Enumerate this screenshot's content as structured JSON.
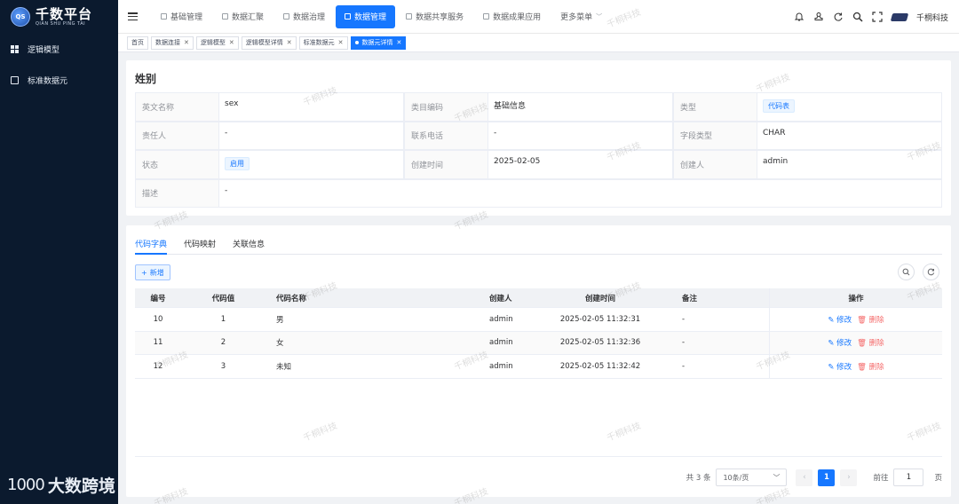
{
  "sidebar": {
    "logo_badge": "QS",
    "logo_title": "千数平台",
    "logo_subtitle": "QIAN SHU PING TAI",
    "items": [
      {
        "label": "逻辑模型",
        "icon": "grid-icon"
      },
      {
        "label": "标准数据元",
        "icon": "document-icon"
      }
    ],
    "brand_mark": "1000",
    "brand_text": "大数跨境"
  },
  "topnav": {
    "items": [
      {
        "label": "基础管理"
      },
      {
        "label": "数据汇聚"
      },
      {
        "label": "数据治理"
      },
      {
        "label": "数据管理",
        "active": true
      },
      {
        "label": "数据共享服务"
      },
      {
        "label": "数据成果应用"
      },
      {
        "label": "更多菜单"
      }
    ],
    "company": "千桐科技"
  },
  "tabs": [
    {
      "label": "首页",
      "closable": false
    },
    {
      "label": "数据连接",
      "closable": true
    },
    {
      "label": "逻辑模型",
      "closable": true
    },
    {
      "label": "逻辑模型详情",
      "closable": true
    },
    {
      "label": "标准数据元",
      "closable": true
    },
    {
      "label": "数据元详情",
      "closable": true,
      "active": true
    }
  ],
  "detail": {
    "title": "姓别",
    "fields": {
      "en_name_label": "英文名称",
      "en_name": "sex",
      "category_label": "类目编码",
      "category": "基础信息",
      "type_label": "类型",
      "type": "代码表",
      "owner_label": "责任人",
      "owner": "-",
      "phone_label": "联系电话",
      "phone": "-",
      "field_type_label": "字段类型",
      "field_type": "CHAR",
      "status_label": "状态",
      "status": "启用",
      "created_label": "创建时间",
      "created": "2025-02-05",
      "creator_label": "创建人",
      "creator": "admin",
      "desc_label": "描述",
      "desc": "-"
    }
  },
  "subtabs": [
    {
      "label": "代码字典",
      "active": true
    },
    {
      "label": "代码映射"
    },
    {
      "label": "关联信息"
    }
  ],
  "toolbar": {
    "add_label": "新增"
  },
  "table": {
    "headers": {
      "id": "编号",
      "value": "代码值",
      "name": "代码名称",
      "creator": "创建人",
      "time": "创建时间",
      "note": "备注",
      "op": "操作"
    },
    "edit_label": "修改",
    "delete_label": "删除",
    "rows": [
      {
        "id": "10",
        "value": "1",
        "name": "男",
        "creator": "admin",
        "time": "2025-02-05 11:32:31",
        "note": "-"
      },
      {
        "id": "11",
        "value": "2",
        "name": "女",
        "creator": "admin",
        "time": "2025-02-05 11:32:36",
        "note": "-"
      },
      {
        "id": "12",
        "value": "3",
        "name": "未知",
        "creator": "admin",
        "time": "2025-02-05 11:32:42",
        "note": "-"
      }
    ]
  },
  "pager": {
    "total": "共 3 条",
    "page_size": "10条/页",
    "current": "1",
    "goto_label": "前往",
    "goto_value": "1",
    "page_unit": "页"
  },
  "watermark": "千桐科技",
  "colors": {
    "primary": "#1677ff",
    "sidebar_bg": "#0b1a2e",
    "danger": "#f56c6c"
  }
}
